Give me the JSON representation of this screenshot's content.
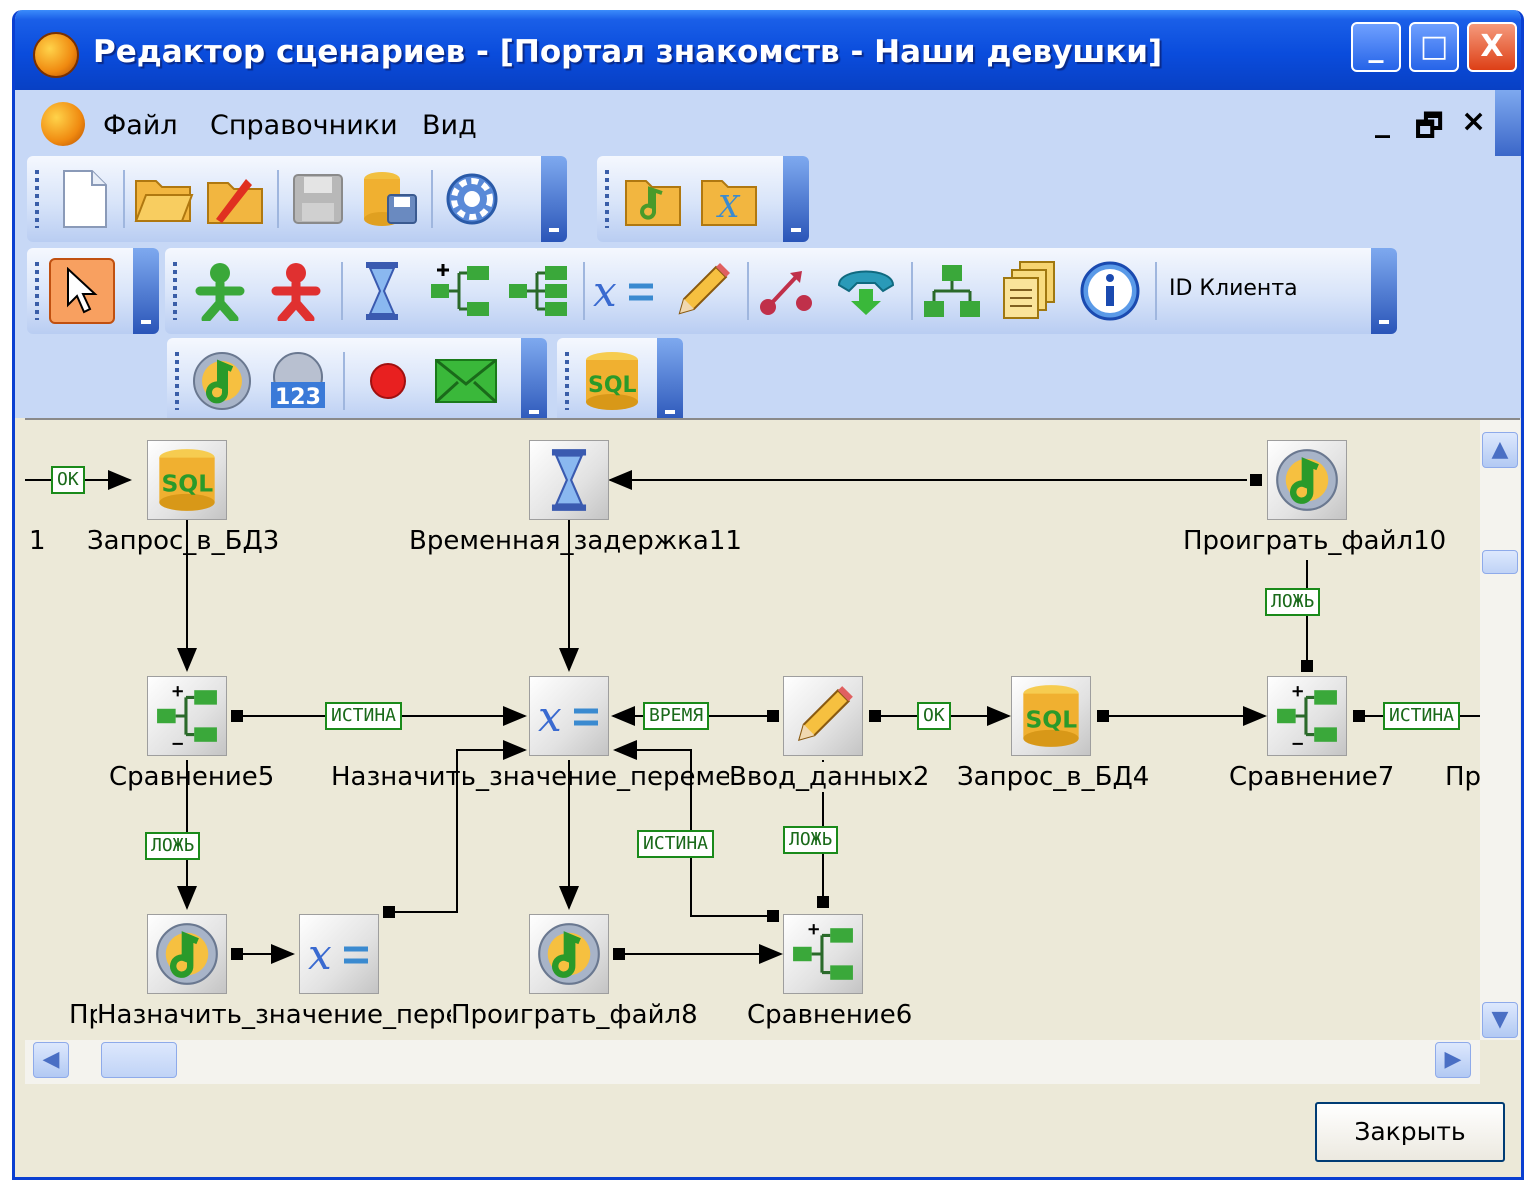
{
  "window": {
    "title": "Редактор сценариев - [Портал знакомств - Наши девушки]",
    "controls": [
      "_",
      "□",
      "X"
    ]
  },
  "menu": {
    "items": [
      "Файл",
      "Справочники",
      "Вид"
    ],
    "mdi_controls": [
      "_",
      "🗗",
      "×"
    ]
  },
  "toolbars": {
    "client_id_label": "ID Клиента"
  },
  "diagram": {
    "nodes": [
      {
        "name": "Запрос_в_БД3",
        "icon": "sql-icon"
      },
      {
        "name": "Временная_задержка11",
        "icon": "hourglass-icon"
      },
      {
        "name": "Проиграть_файл10",
        "icon": "music-icon"
      },
      {
        "name": "Сравнение5",
        "icon": "compare-icon"
      },
      {
        "name": "Назначить_значение_перемен",
        "icon": "assign-icon"
      },
      {
        "name": "Ввод_данных2",
        "icon": "pencil-icon"
      },
      {
        "name": "Запрос_в_БД4",
        "icon": "sql-icon"
      },
      {
        "name": "Сравнение7",
        "icon": "compare-icon"
      },
      {
        "name": "Пр",
        "icon": "music-icon"
      },
      {
        "name": "Назначить_значение_пере",
        "icon": "assign-icon"
      },
      {
        "name": "Проиграть_файл8",
        "icon": "music-icon"
      },
      {
        "name": "Сравнение6",
        "icon": "compare-icon"
      }
    ],
    "partial_labels": {
      "left_fragment": "1",
      "right_fragment": "Пр"
    },
    "edge_labels": {
      "ok": "OK",
      "true": "ИСТИНА",
      "false": "ЛОЖЬ",
      "time": "ВРЕМЯ"
    }
  },
  "footer": {
    "close_button": "Закрыть"
  },
  "colors": {
    "title_blue": "#0a4cdc",
    "edge_green": "#1a8a1a",
    "canvas_bg": "#ece9d8"
  }
}
